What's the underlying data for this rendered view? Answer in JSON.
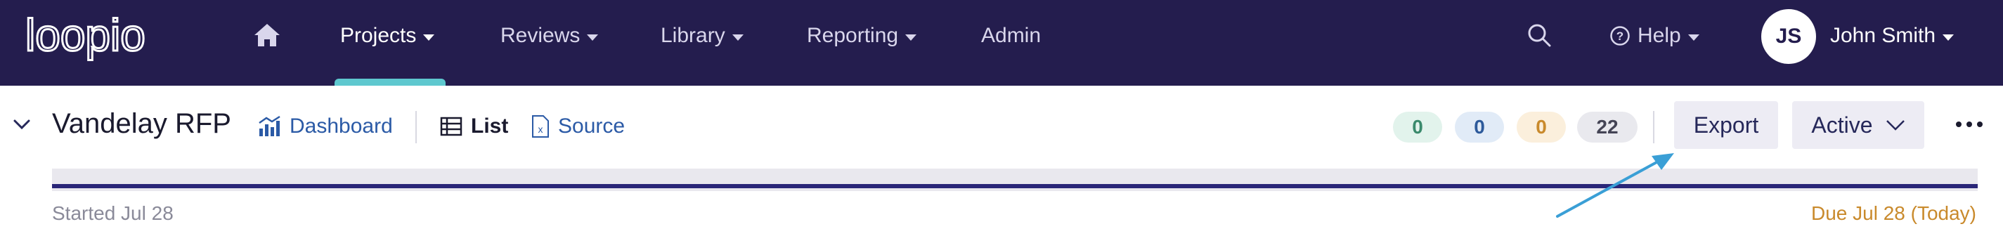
{
  "app": {
    "logo_text": "loopio"
  },
  "nav": {
    "items": [
      {
        "label": "Projects",
        "active": true
      },
      {
        "label": "Reviews"
      },
      {
        "label": "Library"
      },
      {
        "label": "Reporting"
      },
      {
        "label": "Admin"
      }
    ],
    "help_label": "Help",
    "user": {
      "initials": "JS",
      "name": "John Smith"
    }
  },
  "project": {
    "title": "Vandelay RFP",
    "views": {
      "dashboard": "Dashboard",
      "list": "List",
      "source": "Source"
    },
    "counts": {
      "green": "0",
      "blue": "0",
      "orange": "0",
      "total": "22"
    },
    "export_label": "Export",
    "status_label": "Active",
    "started": "Started Jul 28",
    "due": "Due Jul 28 (Today)"
  },
  "colors": {
    "nav_bg": "#241d4e",
    "accent_teal": "#5ec8cf",
    "link_blue": "#2b5aa6",
    "due_orange": "#c98a2c",
    "annotation_arrow": "#3a9fd6"
  },
  "icons": [
    "home-icon",
    "search-icon",
    "help-circle-icon",
    "chevron-down-icon",
    "dashboard-icon",
    "list-icon",
    "source-file-icon",
    "more-icon"
  ]
}
